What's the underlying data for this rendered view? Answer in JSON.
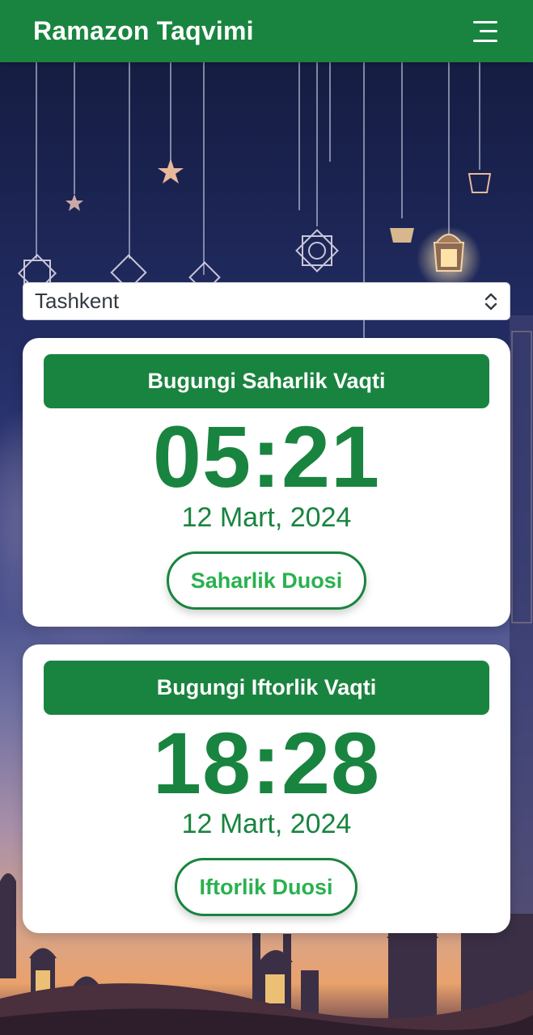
{
  "header": {
    "title": "Ramazon Taqvimi",
    "menu_icon": "hamburger-menu-icon"
  },
  "city_select": {
    "selected": "Tashkent",
    "icon": "select-updown-arrows-icon"
  },
  "sahar_card": {
    "heading": "Bugungi Saharlik Vaqti",
    "time": "05:21",
    "date": "12 Mart, 2024",
    "button_label": "Saharlik Duosi"
  },
  "iftor_card": {
    "heading": "Bugungi Iftorlik Vaqti",
    "time": "18:28",
    "date": "12 Mart, 2024",
    "button_label": "Iftorlik Duosi"
  },
  "colors": {
    "brand_green": "#19843f",
    "button_text_green": "#2ab14f",
    "card_background": "#ffffff"
  }
}
